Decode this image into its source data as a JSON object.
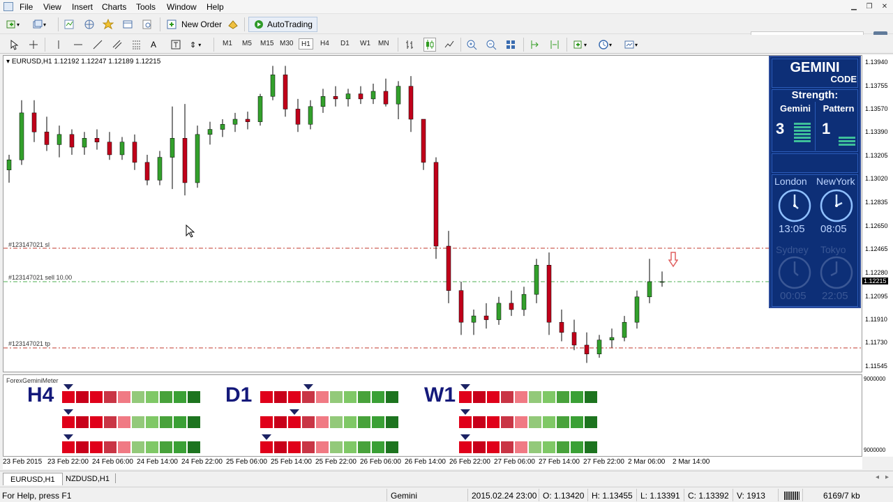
{
  "menu": [
    "File",
    "View",
    "Insert",
    "Charts",
    "Tools",
    "Window",
    "Help"
  ],
  "toolbar": {
    "new_order": "New Order",
    "autotrading": "AutoTrading"
  },
  "timeframes": [
    "M1",
    "M5",
    "M15",
    "M30",
    "H1",
    "H4",
    "D1",
    "W1",
    "MN"
  ],
  "active_timeframe": "H1",
  "chart": {
    "header": "EURUSD,H1  1.12192 1.12247 1.12189 1.12215",
    "sl_label": "#123147021 sl",
    "sell_label": "#123147021 sell 10.00",
    "tp_label": "#123147021 tp",
    "current_price": "1.12215",
    "price_ticks": [
      "1.13940",
      "1.13755",
      "1.13570",
      "1.13390",
      "1.13205",
      "1.13020",
      "1.12835",
      "1.12650",
      "1.12465",
      "1.12280",
      "1.12095",
      "1.11910",
      "1.11730",
      "1.11545"
    ],
    "indicator_ticks": [
      "9000000",
      "9000000"
    ],
    "time_ticks": [
      "23 Feb 2015",
      "23 Feb 22:00",
      "24 Feb 06:00",
      "24 Feb 14:00",
      "24 Feb 22:00",
      "25 Feb 06:00",
      "25 Feb 14:00",
      "25 Feb 22:00",
      "26 Feb 06:00",
      "26 Feb 14:00",
      "26 Feb 22:00",
      "27 Feb 06:00",
      "27 Feb 14:00",
      "27 Feb 22:00",
      "2 Mar 06:00",
      "2 Mar 14:00"
    ]
  },
  "chart_data": {
    "type": "candlestick",
    "title": "EURUSD,H1",
    "ylim": [
      1.115,
      1.14
    ],
    "series": [
      {
        "name": "EURUSD",
        "ohlc": [
          [
            1.131,
            1.1322,
            1.13,
            1.1318
          ],
          [
            1.1318,
            1.1365,
            1.1314,
            1.1355
          ],
          [
            1.1355,
            1.1365,
            1.1332,
            1.134
          ],
          [
            1.134,
            1.1352,
            1.1325,
            1.133
          ],
          [
            1.133,
            1.1345,
            1.132,
            1.1338
          ],
          [
            1.1338,
            1.1342,
            1.1322,
            1.1328
          ],
          [
            1.1328,
            1.134,
            1.1322,
            1.1335
          ],
          [
            1.1335,
            1.1342,
            1.1326,
            1.1332
          ],
          [
            1.1332,
            1.134,
            1.1318,
            1.1322
          ],
          [
            1.1322,
            1.1336,
            1.1318,
            1.1332
          ],
          [
            1.1332,
            1.1338,
            1.131,
            1.1316
          ],
          [
            1.1316,
            1.1322,
            1.1298,
            1.1302
          ],
          [
            1.1302,
            1.1325,
            1.1298,
            1.132
          ],
          [
            1.132,
            1.136,
            1.1295,
            1.1335
          ],
          [
            1.1335,
            1.1362,
            1.129,
            1.13
          ],
          [
            1.13,
            1.1345,
            1.1296,
            1.1338
          ],
          [
            1.1338,
            1.1348,
            1.133,
            1.1342
          ],
          [
            1.1342,
            1.135,
            1.1336,
            1.1346
          ],
          [
            1.1346,
            1.1355,
            1.134,
            1.135
          ],
          [
            1.135,
            1.1356,
            1.1342,
            1.1348
          ],
          [
            1.1348,
            1.137,
            1.1345,
            1.1368
          ],
          [
            1.1368,
            1.1392,
            1.1365,
            1.1385
          ],
          [
            1.1385,
            1.1392,
            1.1352,
            1.1358
          ],
          [
            1.1358,
            1.1366,
            1.134,
            1.1346
          ],
          [
            1.1346,
            1.1365,
            1.1342,
            1.136
          ],
          [
            1.136,
            1.1374,
            1.1355,
            1.1368
          ],
          [
            1.1368,
            1.1376,
            1.136,
            1.1366
          ],
          [
            1.1366,
            1.1374,
            1.136,
            1.137
          ],
          [
            1.137,
            1.1376,
            1.1362,
            1.1366
          ],
          [
            1.1366,
            1.1378,
            1.1362,
            1.1372
          ],
          [
            1.1372,
            1.1382,
            1.136,
            1.1362
          ],
          [
            1.1362,
            1.138,
            1.135,
            1.1376
          ],
          [
            1.1376,
            1.1384,
            1.134,
            1.135
          ],
          [
            1.135,
            1.1345,
            1.131,
            1.1316
          ],
          [
            1.1316,
            1.132,
            1.124,
            1.125
          ],
          [
            1.125,
            1.1262,
            1.1205,
            1.1215
          ],
          [
            1.1215,
            1.1222,
            1.118,
            1.119
          ],
          [
            1.119,
            1.12,
            1.118,
            1.1195
          ],
          [
            1.1195,
            1.1205,
            1.1185,
            1.1192
          ],
          [
            1.1192,
            1.121,
            1.1188,
            1.1205
          ],
          [
            1.1205,
            1.1215,
            1.1195,
            1.12
          ],
          [
            1.12,
            1.1218,
            1.1195,
            1.1212
          ],
          [
            1.1212,
            1.124,
            1.1205,
            1.1235
          ],
          [
            1.1235,
            1.1245,
            1.118,
            1.119
          ],
          [
            1.119,
            1.12,
            1.1175,
            1.1182
          ],
          [
            1.1182,
            1.1192,
            1.1168,
            1.1172
          ],
          [
            1.1172,
            1.1182,
            1.1158,
            1.1165
          ],
          [
            1.1165,
            1.118,
            1.1162,
            1.1176
          ],
          [
            1.1176,
            1.1185,
            1.117,
            1.1178
          ],
          [
            1.1178,
            1.1195,
            1.1175,
            1.119
          ],
          [
            1.119,
            1.1215,
            1.1185,
            1.121
          ],
          [
            1.121,
            1.124,
            1.1205,
            1.1222
          ],
          [
            1.1222,
            1.123,
            1.1218,
            1.1222
          ]
        ]
      }
    ]
  },
  "gemini": {
    "title": "GEMINI",
    "subtitle": "CODE",
    "strength": "Strength:",
    "col1": "Gemini",
    "col2": "Pattern",
    "gemini_value": "3",
    "pattern_value": "1",
    "city1": "London",
    "city2": "NewYork",
    "time1": "13:05",
    "time2": "08:05",
    "city3": "Sydney",
    "city4": "Tokyo",
    "time3": "00:05",
    "time4": "22:05",
    "text_color": "#ffffff",
    "bg_color": "#0d2f77"
  },
  "meter": {
    "label": "ForexGeminiMeter",
    "groups": [
      {
        "name": "H4",
        "markers": [
          0,
          0,
          0
        ]
      },
      {
        "name": "D1",
        "markers": [
          3,
          2,
          0
        ]
      },
      {
        "name": "W1",
        "markers": [
          0,
          0,
          0
        ]
      }
    ],
    "colors": [
      "#e0001a",
      "#e0001a",
      "#e0001a",
      "#e13b4a",
      "#f07a84",
      "#a8dc8c",
      "#7fc866",
      "#5bb54a",
      "#3aa035",
      "#2c8a2c"
    ],
    "colors_dark": [
      "#c8001a",
      "#c8001a",
      "#c8001a",
      "#c93545",
      "#d96b75",
      "#93c97a",
      "#6ab556",
      "#48a23b",
      "#2e8a2c",
      "#1d741f"
    ]
  },
  "tabs": [
    "EURUSD,H1",
    "NZDUSD,H1"
  ],
  "status": {
    "help": "For Help, press F1",
    "profile": "Gemini",
    "datetime": "2015.02.24 23:00",
    "open": "O: 1.13420",
    "high": "H: 1.13455",
    "low": "L: 1.13391",
    "close": "C: 1.13392",
    "volume": "V: 1913",
    "traffic": "6169/7 kb"
  }
}
